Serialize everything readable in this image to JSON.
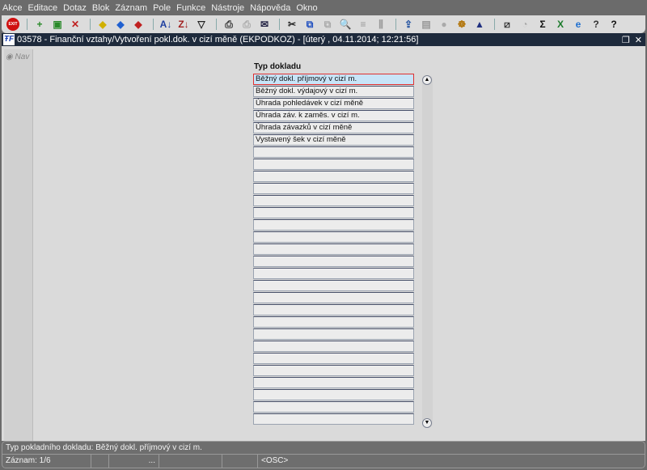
{
  "menu": [
    "Akce",
    "Editace",
    "Dotaz",
    "Blok",
    "Záznam",
    "Pole",
    "Funkce",
    "Nástroje",
    "Nápověda",
    "Okno"
  ],
  "toolbar": [
    {
      "icon": "exit-icon",
      "glyph": "EXIT",
      "color": "#d01010"
    },
    {
      "icon": "insert-record-icon",
      "glyph": "+",
      "color": "#2a8a2a"
    },
    {
      "icon": "save-record-icon",
      "glyph": "▣",
      "color": "#2a8a2a"
    },
    {
      "icon": "delete-record-icon",
      "glyph": "✕",
      "color": "#c02020"
    },
    {
      "icon": "query-yellow-icon",
      "glyph": "◆",
      "color": "#d0b000"
    },
    {
      "icon": "query-run-icon",
      "glyph": "◆",
      "color": "#2060d0"
    },
    {
      "icon": "query-cancel-icon",
      "glyph": "◆",
      "color": "#c02020"
    },
    {
      "icon": "sort-asc-icon",
      "glyph": "A↓",
      "color": "#2040a0"
    },
    {
      "icon": "sort-desc-icon",
      "glyph": "Z↓",
      "color": "#a02020"
    },
    {
      "icon": "filter-icon",
      "glyph": "▽",
      "color": "#222"
    },
    {
      "icon": "print-icon",
      "glyph": "⎙",
      "color": "#333"
    },
    {
      "icon": "print-disabled-icon",
      "glyph": "⎙",
      "color": "#aaa"
    },
    {
      "icon": "mail-icon",
      "glyph": "✉",
      "color": "#224"
    },
    {
      "icon": "cut-icon",
      "glyph": "✂",
      "color": "#222"
    },
    {
      "icon": "copy-icon",
      "glyph": "⧉",
      "color": "#2050c0"
    },
    {
      "icon": "paste-icon",
      "glyph": "⧉",
      "color": "#aaa"
    },
    {
      "icon": "find-icon",
      "glyph": "🔍",
      "color": "#444"
    },
    {
      "icon": "indent-icon",
      "glyph": "≡",
      "color": "#999"
    },
    {
      "icon": "columns-icon",
      "glyph": "⫼",
      "color": "#999"
    },
    {
      "icon": "export-icon",
      "glyph": "⇪",
      "color": "#2050a0"
    },
    {
      "icon": "document-icon",
      "glyph": "▤",
      "color": "#999"
    },
    {
      "icon": "globe-icon",
      "glyph": "●",
      "color": "#aaa"
    },
    {
      "icon": "wheel-icon",
      "glyph": "☸",
      "color": "#b07000"
    },
    {
      "icon": "triangle-icon",
      "glyph": "▲",
      "color": "#203080"
    },
    {
      "icon": "chart-icon",
      "glyph": "⧄",
      "color": "#333"
    },
    {
      "icon": "clock-icon",
      "glyph": "◔",
      "color": "#aaa"
    },
    {
      "icon": "sum-icon",
      "glyph": "Σ",
      "color": "#111"
    },
    {
      "icon": "excel-icon",
      "glyph": "X",
      "color": "#1a7a2a"
    },
    {
      "icon": "ie-icon",
      "glyph": "e",
      "color": "#2070d0"
    },
    {
      "icon": "help-lock-icon",
      "glyph": "?",
      "color": "#333"
    },
    {
      "icon": "help-icon",
      "glyph": "?",
      "color": "#111"
    }
  ],
  "window": {
    "title": "03578 - Finanční vztahy/Vytvoření pokl.dok. v cizí měně (EKPODKOZ) - [úterý  , 04.11.2014; 12:21:56]",
    "logo": "ŦF"
  },
  "nav": "Nav",
  "field_label": "Typ dokladu",
  "rows": [
    "Běžný dokl. příjmový v cizí m.",
    "Běžný dokl. výdajový v cizí m.",
    "Úhrada pohledávek v cizí měně",
    "Úhrada záv. k zaměs. v cizí m.",
    "Úhrada závazků v cizí měně",
    "Vystavený šek v cizí měně",
    "",
    "",
    "",
    "",
    "",
    "",
    "",
    "",
    "",
    "",
    "",
    "",
    "",
    "",
    "",
    "",
    "",
    "",
    "",
    "",
    "",
    "",
    ""
  ],
  "status": {
    "hint": "Typ pokladního dokladu: Běžný dokl. příjmový v cizí m.",
    "record": "Záznam: 1/6",
    "ellipsis": "...",
    "mode": "<OSC>"
  }
}
